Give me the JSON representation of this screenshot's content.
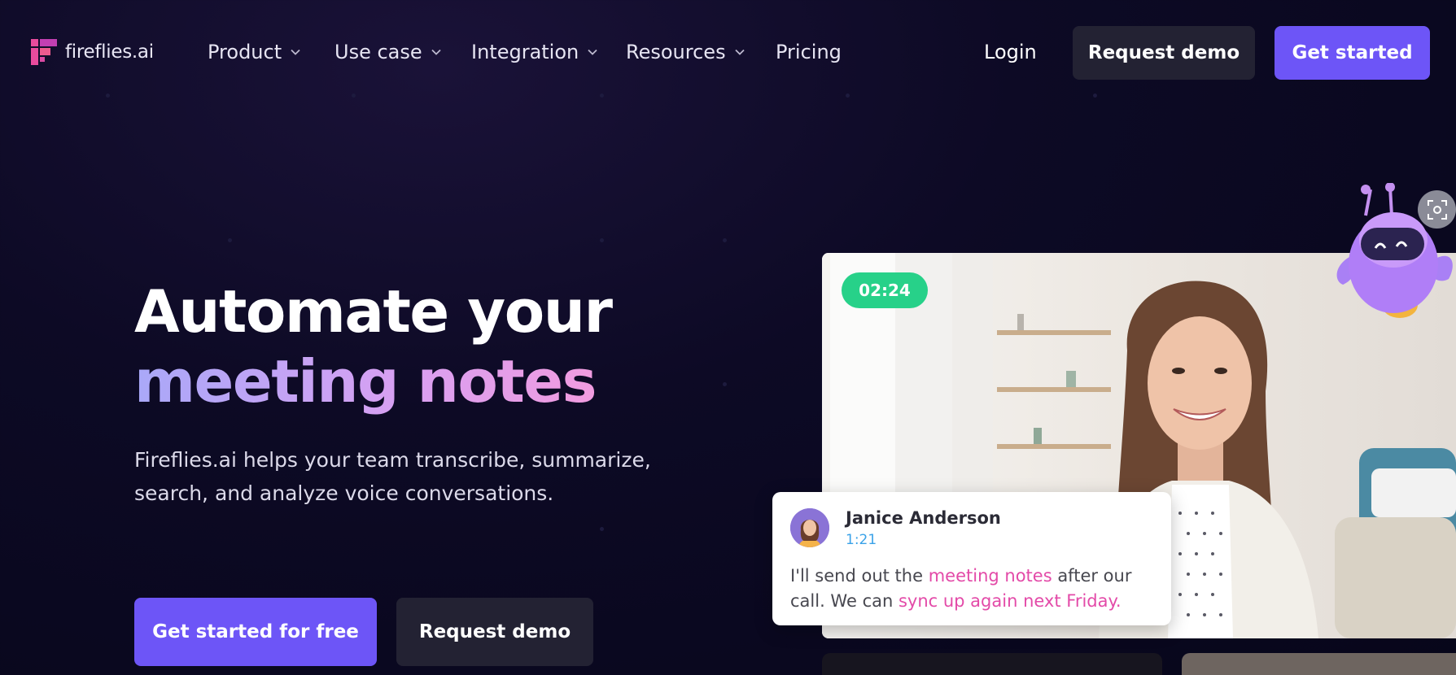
{
  "brand": {
    "name": "fireflies.ai"
  },
  "nav": {
    "items": [
      {
        "label": "Product",
        "has_dropdown": true
      },
      {
        "label": "Use case",
        "has_dropdown": true
      },
      {
        "label": "Integration",
        "has_dropdown": true
      },
      {
        "label": "Resources",
        "has_dropdown": true
      },
      {
        "label": "Pricing",
        "has_dropdown": false
      }
    ],
    "login": "Login",
    "request_demo": "Request demo",
    "get_started": "Get started"
  },
  "hero": {
    "title_line1": "Automate your",
    "title_line2": "meeting notes",
    "subtitle": "Fireflies.ai helps your team transcribe, summarize, search, and analyze voice conversations.",
    "cta_primary": "Get started for free",
    "cta_secondary": "Request demo"
  },
  "media": {
    "timer": "02:24",
    "transcript": {
      "speaker": "Janice Anderson",
      "timestamp": "1:21",
      "text_part1": "I'll send out the ",
      "highlight1": "meeting notes",
      "text_part2": " after our call. We can ",
      "highlight2": "sync up again next Friday."
    }
  },
  "colors": {
    "accent": "#6d55f7",
    "dark_button": "#232233",
    "timer_green": "#27d189",
    "highlight_pink": "#e34aa8",
    "timestamp_blue": "#3aa2e8",
    "background": "#0d0a25"
  },
  "icons": {
    "dropdown": "chevron-down-icon",
    "logo": "fireflies-logo-icon",
    "scan": "scan-icon",
    "mascot": "robot-mascot"
  }
}
